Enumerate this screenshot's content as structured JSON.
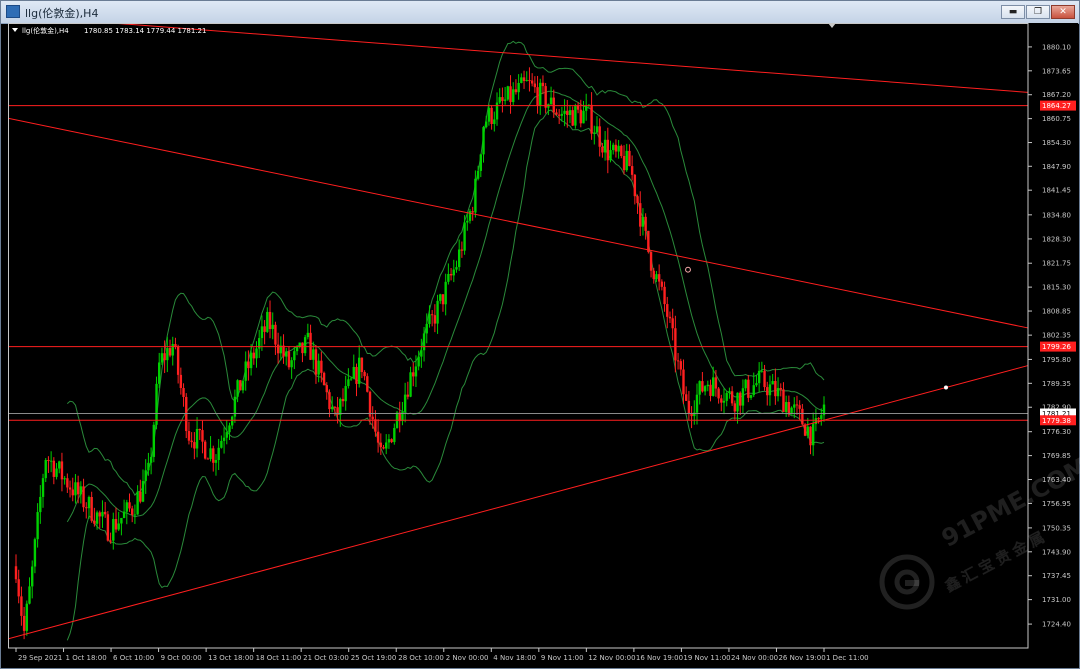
{
  "window": {
    "title": "llg(伦敦金),H4",
    "buttons": {
      "minimize": "▬",
      "maximize": "❐",
      "close": "✕"
    }
  },
  "chart_header": {
    "label": "llg(伦敦金),H4",
    "ohlc": "1780.85 1783.14 1779.44 1781.21"
  },
  "watermark": {
    "brand": "91PME.COM",
    "tagline": "鑫汇宝贵金属"
  },
  "colors": {
    "background": "#000000",
    "grid": "#606060",
    "axis_text": "#c8c8c8",
    "bull": "#00d000",
    "bear": "#ff2020",
    "band": "#2a8a3a",
    "line": "#ff1f1f"
  },
  "chart_data": {
    "type": "candlestick",
    "symbol": "llg(伦敦金)",
    "timeframe": "H4",
    "last_price": 1781.21,
    "ylim": [
      1717.95,
      1886.55
    ],
    "y_ticks": [
      1880.1,
      1873.65,
      1867.2,
      1860.75,
      1854.3,
      1847.9,
      1841.45,
      1834.8,
      1828.3,
      1821.75,
      1815.3,
      1808.85,
      1802.35,
      1795.8,
      1789.35,
      1782.9,
      1776.3,
      1769.85,
      1763.4,
      1756.95,
      1750.35,
      1743.9,
      1737.45,
      1731.0,
      1724.4
    ],
    "x_ticks": [
      "29 Sep 2021",
      "1 Oct 18:00",
      "6 Oct 10:00",
      "9 Oct 00:00",
      "13 Oct 18:00",
      "18 Oct 11:00",
      "21 Oct 03:00",
      "25 Oct 19:00",
      "28 Oct 10:00",
      "2 Nov 00:00",
      "4 Nov 18:00",
      "9 Nov 11:00",
      "12 Nov 00:00",
      "16 Nov 19:00",
      "19 Nov 11:00",
      "24 Nov 00:00",
      "26 Nov 19:00",
      "1 Dec 11:00"
    ],
    "price_labels": [
      {
        "value": 1864.27,
        "color": "#ff1f1f"
      },
      {
        "value": 1799.26,
        "color": "#ff1f1f"
      },
      {
        "value": 1781.21,
        "color": "#ffffff"
      },
      {
        "value": 1779.38,
        "color": "#ff1f1f"
      }
    ],
    "horizontal_lines": [
      1864.27,
      1799.26,
      1779.38
    ],
    "trend_lines": [
      {
        "from": [
          "29 Sep 2021",
          1888.5
        ],
        "to": [
          "1 Dec 11:00",
          1872.0
        ]
      },
      {
        "from": [
          "29 Sep 2021",
          1860.4
        ],
        "to": [
          "1 Dec 11:00",
          1815.6
        ]
      },
      {
        "from": [
          "29 Sep 2021",
          1721.0
        ],
        "to": [
          "1 Dec 11:00",
          1779.4
        ]
      }
    ],
    "indicators": [
      "Bollinger Bands"
    ],
    "grid": false
  }
}
